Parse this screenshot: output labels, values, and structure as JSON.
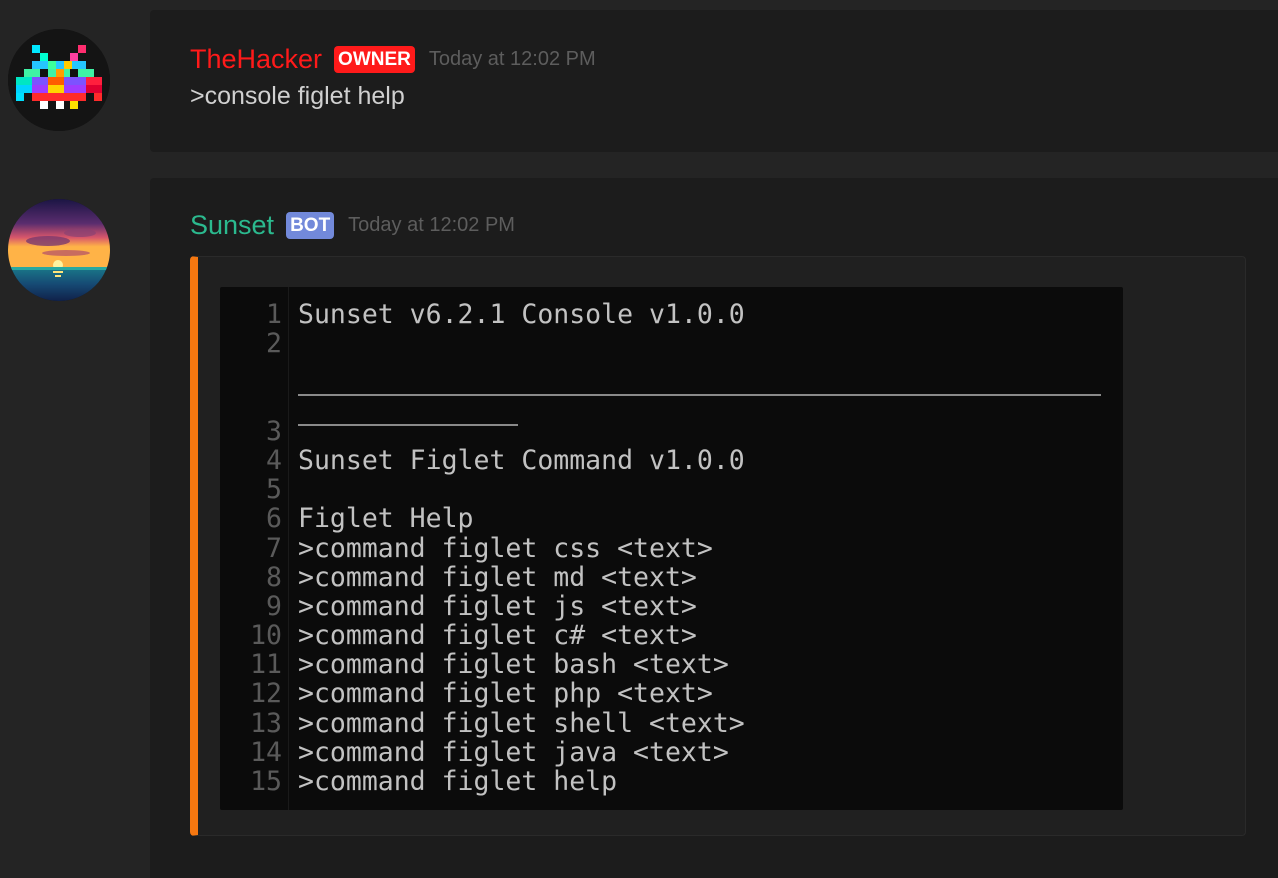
{
  "messages": [
    {
      "username": "TheHacker",
      "username_color": "#ff1a1a",
      "badge": "OWNER",
      "badge_color": "#ff1a1a",
      "timestamp": "Today at 12:02 PM",
      "content": ">console figlet help",
      "avatar_icon": "pixel-space-invader-icon"
    },
    {
      "username": "Sunset",
      "username_color": "#2bb98e",
      "badge": "BOT",
      "badge_color": "#7289da",
      "timestamp": "Today at 12:02 PM",
      "avatar_icon": "sunset-landscape-icon",
      "embed": {
        "accent_color": "#f57710",
        "code_lines": [
          {
            "n": "1",
            "text": "Sunset v6.2.1 Console v1.0.0"
          },
          {
            "n": "2",
            "text": ""
          },
          {
            "n": "3",
            "text": ""
          },
          {
            "n": "4",
            "text": "Sunset Figlet Command v1.0.0"
          },
          {
            "n": "5",
            "text": ""
          },
          {
            "n": "6",
            "text": "Figlet Help"
          },
          {
            "n": "7",
            "text": ">command figlet css <text>"
          },
          {
            "n": "8",
            "text": ">command figlet md <text>"
          },
          {
            "n": "9",
            "text": ">command figlet js <text>"
          },
          {
            "n": "10",
            "text": ">command figlet c# <text>"
          },
          {
            "n": "11",
            "text": ">command figlet bash <text>"
          },
          {
            "n": "12",
            "text": ">command figlet php <text>"
          },
          {
            "n": "13",
            "text": ">command figlet shell <text>"
          },
          {
            "n": "14",
            "text": ">command figlet java <text>"
          },
          {
            "n": "15",
            "text": ">command figlet help"
          }
        ]
      }
    }
  ]
}
